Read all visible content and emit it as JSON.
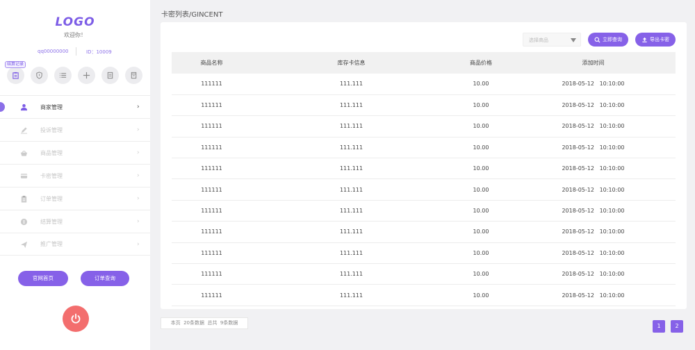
{
  "sidebar": {
    "logo": "LOGO",
    "welcome": "欢迎你！",
    "account": "qq00000000",
    "user_id": "ID：10009",
    "quick_tag": "结算记录",
    "quick_icons": [
      "clipboard-icon",
      "shield-icon",
      "list-icon",
      "plus-icon",
      "document-icon",
      "receipt-icon"
    ],
    "menu": [
      {
        "label": "商家管理",
        "icon": "user-icon",
        "active": true
      },
      {
        "label": "投诉管理",
        "icon": "pencil-icon",
        "active": false
      },
      {
        "label": "商品管理",
        "icon": "basket-icon",
        "active": false
      },
      {
        "label": "卡密管理",
        "icon": "card-icon",
        "active": false
      },
      {
        "label": "订单管理",
        "icon": "clipboard-icon",
        "active": false
      },
      {
        "label": "结算管理",
        "icon": "coin-icon",
        "active": false
      },
      {
        "label": "推广管理",
        "icon": "send-icon",
        "active": false
      }
    ],
    "arrow": "›",
    "btn_home": "官网首页",
    "btn_order": "订单查询"
  },
  "main": {
    "breadcrumb": "卡密列表/GINCENT",
    "select_placeholder": "选择商品",
    "search_btn": "立即查询",
    "export_btn": "导出卡密",
    "columns": [
      "商品名称",
      "库存卡信息",
      "商品价格",
      "添加时间"
    ],
    "rows": [
      [
        "111111",
        "111.111",
        "10.00",
        "2018-05-12   10:10:00"
      ],
      [
        "111111",
        "111.111",
        "10.00",
        "2018-05-12   10:10:00"
      ],
      [
        "111111",
        "111.111",
        "10.00",
        "2018-05-12   10:10:00"
      ],
      [
        "111111",
        "111.111",
        "10.00",
        "2018-05-12   10:10:00"
      ],
      [
        "111111",
        "111.111",
        "10.00",
        "2018-05-12   10:10:00"
      ],
      [
        "111111",
        "111.111",
        "10.00",
        "2018-05-12   10:10:00"
      ],
      [
        "111111",
        "111.111",
        "10.00",
        "2018-05-12   10:10:00"
      ],
      [
        "111111",
        "111.111",
        "10.00",
        "2018-05-12   10:10:00"
      ],
      [
        "111111",
        "111.111",
        "10.00",
        "2018-05-12   10:10:00"
      ],
      [
        "111111",
        "111.111",
        "10.00",
        "2018-05-12   10:10:00"
      ],
      [
        "111111",
        "111.111",
        "10.00",
        "2018-05-12   10:10:00"
      ]
    ],
    "footer_info": "本页  20条数据  总共  9条数据",
    "pages": [
      "1",
      "2"
    ]
  },
  "colors": {
    "accent": "#8661e8",
    "power": "#f36e6e"
  }
}
